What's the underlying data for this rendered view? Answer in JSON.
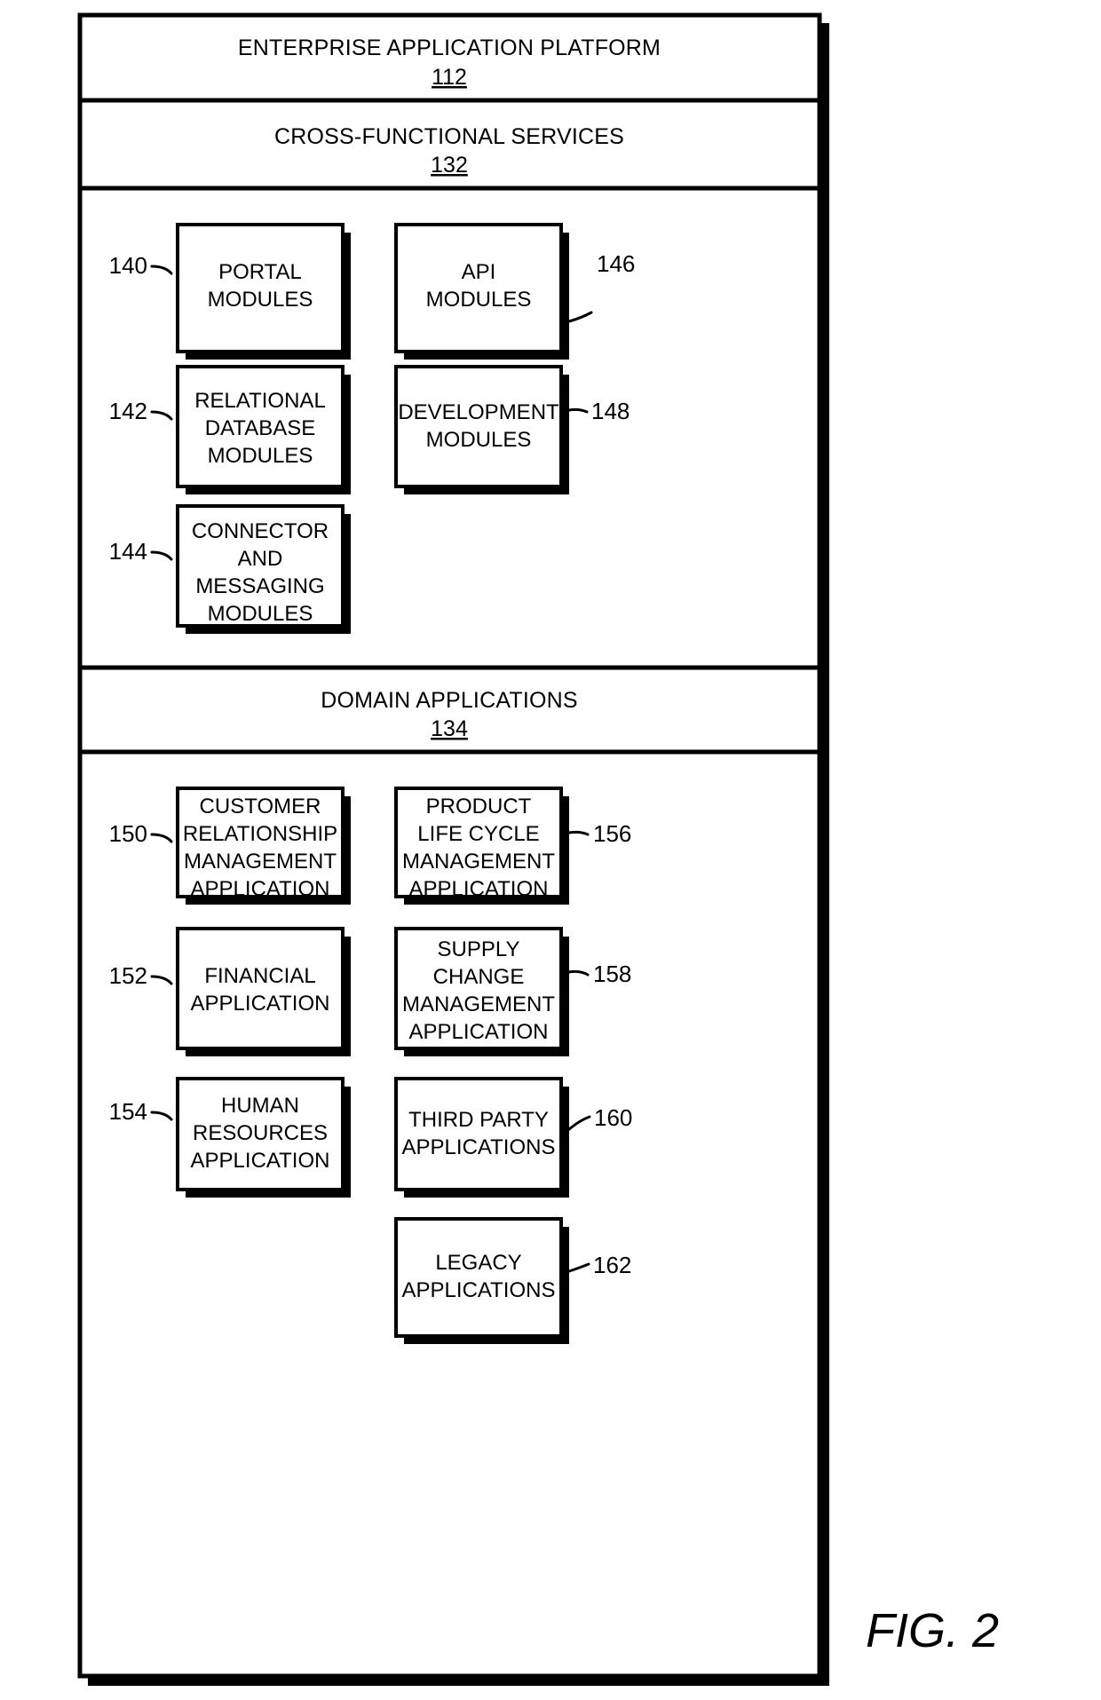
{
  "figure": {
    "caption": "FIG. 2"
  },
  "bands": [
    {
      "title": "ENTERPRISE APPLICATION PLATFORM",
      "number": "112"
    },
    {
      "title": "CROSS-FUNCTIONAL SERVICES",
      "number": "132"
    },
    {
      "title": "DOMAIN APPLICATIONS",
      "number": "134"
    }
  ],
  "cross_functional_modules": [
    {
      "ref": "140",
      "ref_side": "left",
      "lines": [
        "PORTAL",
        "MODULES"
      ]
    },
    {
      "ref": "146",
      "ref_side": "right",
      "lines": [
        "API",
        "MODULES"
      ]
    },
    {
      "ref": "142",
      "ref_side": "left",
      "lines": [
        "RELATIONAL",
        "DATABASE",
        "MODULES"
      ]
    },
    {
      "ref": "148",
      "ref_side": "right",
      "lines": [
        "DEVELOPMENT",
        "MODULES"
      ]
    },
    {
      "ref": "144",
      "ref_side": "left",
      "lines": [
        "CONNECTOR",
        "AND",
        "MESSAGING",
        "MODULES"
      ]
    }
  ],
  "domain_applications": [
    {
      "ref": "150",
      "ref_side": "left",
      "lines": [
        "CUSTOMER",
        "RELATIONSHIP",
        "MANAGEMENT",
        "APPLICATION"
      ]
    },
    {
      "ref": "156",
      "ref_side": "right",
      "lines": [
        "PRODUCT",
        "LIFE CYCLE",
        "MANAGEMENT",
        "APPLICATION"
      ]
    },
    {
      "ref": "152",
      "ref_side": "left",
      "lines": [
        "FINANCIAL",
        "APPLICATION"
      ]
    },
    {
      "ref": "158",
      "ref_side": "right",
      "lines": [
        "SUPPLY",
        "CHANGE",
        "MANAGEMENT",
        "APPLICATION"
      ]
    },
    {
      "ref": "154",
      "ref_side": "left",
      "lines": [
        "HUMAN",
        "RESOURCES",
        "APPLICATION"
      ]
    },
    {
      "ref": "160",
      "ref_side": "right",
      "lines": [
        "THIRD PARTY",
        "APPLICATIONS"
      ]
    },
    {
      "ref": "162",
      "ref_side": "right",
      "lines": [
        "LEGACY",
        "APPLICATIONS"
      ]
    }
  ],
  "colors": {
    "stroke": "#000000",
    "background": "#ffffff"
  }
}
